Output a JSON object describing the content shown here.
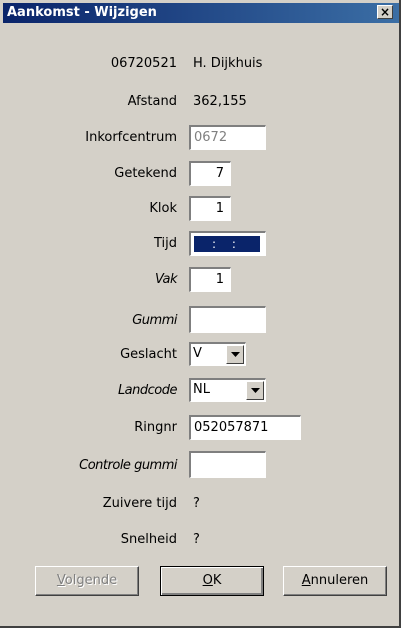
{
  "window": {
    "title": "Aankomst - Wijzigen",
    "close_glyph": "×"
  },
  "header": {
    "number": "06720521",
    "name": "H. Dijkhuis"
  },
  "rows": {
    "afstand": {
      "label": "Afstand",
      "value": "362,155"
    },
    "inkorfcentrum": {
      "label": "Inkorfcentrum",
      "value": "0672"
    },
    "getekend": {
      "label": "Getekend",
      "value": "7"
    },
    "klok": {
      "label": "Klok",
      "value": "1"
    },
    "tijd": {
      "label": "Tijd",
      "value": ": :"
    },
    "vak": {
      "label": "Vak",
      "value": "1"
    },
    "gummi": {
      "label": "Gummi",
      "value": ""
    },
    "geslacht": {
      "label": "Geslacht",
      "value": "V"
    },
    "landcode": {
      "label": "Landcode",
      "value": "NL"
    },
    "ringnr": {
      "label": "Ringnr",
      "value": "052057871"
    },
    "controle_gummi": {
      "label": "Controle gummi",
      "value": ""
    },
    "zuivere_tijd": {
      "label": "Zuivere tijd",
      "value": "?"
    },
    "snelheid": {
      "label": "Snelheid",
      "value": "?"
    }
  },
  "buttons": {
    "volgende": {
      "first": "V",
      "rest": "olgende",
      "enabled": false
    },
    "ok": {
      "first": "O",
      "rest": "K"
    },
    "annuleren": {
      "first": "A",
      "rest": "nnuleren"
    }
  }
}
